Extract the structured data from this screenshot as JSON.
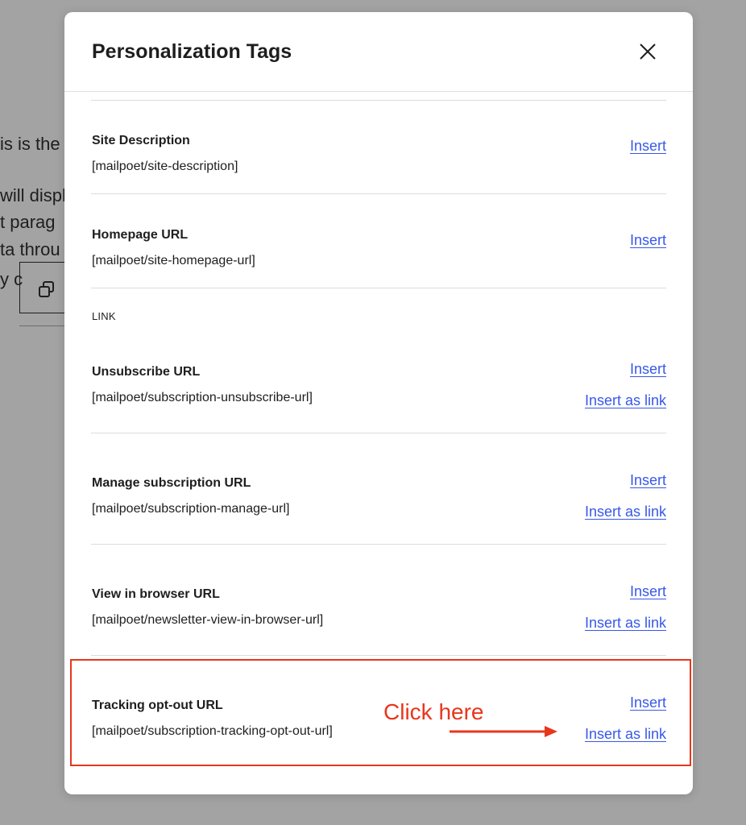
{
  "background": {
    "lines": [
      "is is the",
      "will displ",
      "t parag",
      "ta throu",
      "y c"
    ]
  },
  "modal": {
    "title": "Personalization Tags",
    "tags": [
      {
        "name": "Site Description",
        "token": "[mailpoet/site-description]",
        "insert": "Insert"
      },
      {
        "name": "Homepage URL",
        "token": "[mailpoet/site-homepage-url]",
        "insert": "Insert"
      }
    ],
    "group_label": "LINK",
    "link_tags": [
      {
        "name": "Unsubscribe URL",
        "token": "[mailpoet/subscription-unsubscribe-url]",
        "insert": "Insert",
        "insert_link": "Insert as link"
      },
      {
        "name": "Manage subscription URL",
        "token": "[mailpoet/subscription-manage-url]",
        "insert": "Insert",
        "insert_link": "Insert as link"
      },
      {
        "name": "View in browser URL",
        "token": "[mailpoet/newsletter-view-in-browser-url]",
        "insert": "Insert",
        "insert_link": "Insert as link"
      },
      {
        "name": "Tracking opt-out URL",
        "token": "[mailpoet/subscription-tracking-opt-out-url]",
        "insert": "Insert",
        "insert_link": "Insert as link"
      }
    ]
  },
  "annotation": {
    "text": "Click here",
    "color": "#e8361c"
  },
  "colors": {
    "link": "#3858e9",
    "overlay": "#a3a3a3"
  }
}
